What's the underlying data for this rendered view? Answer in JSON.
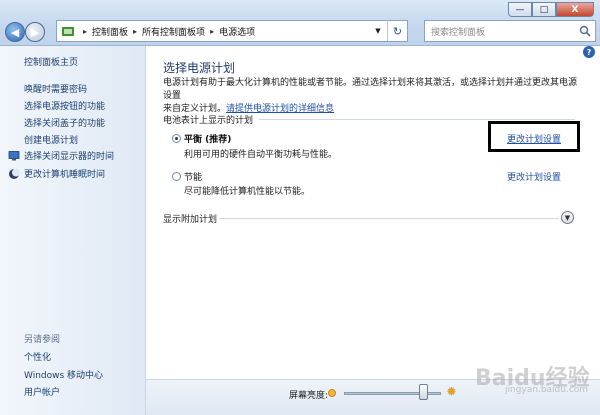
{
  "window": {
    "minimize": "—",
    "maximize": "□",
    "close": "X"
  },
  "address": {
    "crumbs": [
      "控制面板",
      "所有控制面板项",
      "电源选项"
    ],
    "search_placeholder": "搜索控制面板"
  },
  "sidebar": {
    "home": "控制面板主页",
    "links": [
      "唤醒时需要密码",
      "选择电源按钮的功能",
      "选择关闭盖子的功能",
      "创建电源计划"
    ],
    "icon_links": [
      "选择关闭显示器的时间",
      "更改计算机睡眠时间"
    ],
    "see_also_title": "另请参阅",
    "see_also": [
      "个性化",
      "Windows 移动中心",
      "用户帐户"
    ]
  },
  "main": {
    "title": "选择电源计划",
    "desc_line1": "电源计划有助于最大化计算机的性能或者节能。通过选择计划来将其激活，或选择计划并通过更改其电源设置",
    "desc_line2_prefix": "来自定义计划。",
    "desc_link": "请提供电源计划的详细信息",
    "section_header": "电池表计上显示的计划",
    "plans": [
      {
        "name": "平衡 (推荐)",
        "desc": "利用可用的硬件自动平衡功耗与性能。",
        "link": "更改计划设置",
        "selected": true
      },
      {
        "name": "节能",
        "desc": "尽可能降低计算机性能以节能。",
        "link": "更改计划设置",
        "selected": false
      }
    ],
    "extra_plans": "显示附加计划"
  },
  "bottom": {
    "brightness_label": "屏幕亮度:",
    "brightness_level": 0.85
  },
  "watermark": {
    "text": "Baidu经验",
    "sub": "jingyan.baidu.com"
  }
}
